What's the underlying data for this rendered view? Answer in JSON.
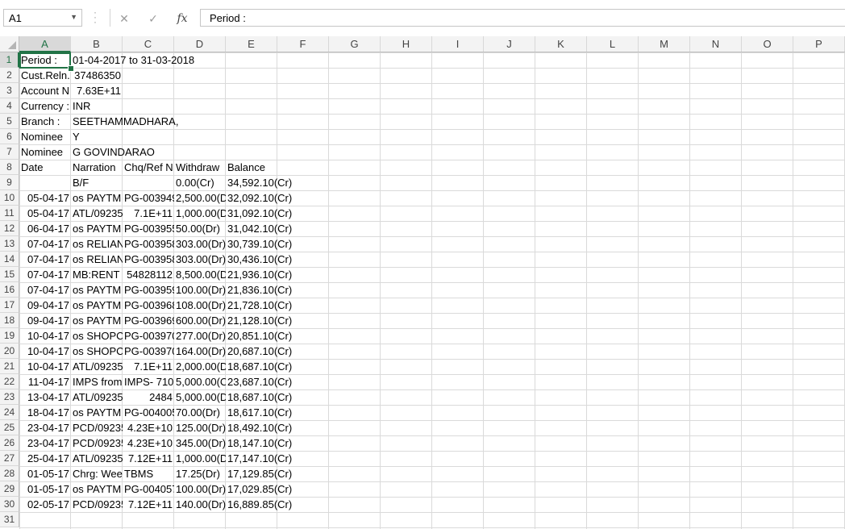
{
  "formula_bar": {
    "name_box": "A1",
    "cancel_icon": "✕",
    "enter_icon": "✓",
    "fx_label": "fx",
    "formula_value": "Period :"
  },
  "columns": [
    "A",
    "B",
    "C",
    "D",
    "E",
    "F",
    "G",
    "H",
    "I",
    "J",
    "K",
    "L",
    "M",
    "N",
    "O",
    "P"
  ],
  "rows": [
    {
      "num": "1",
      "A": "Period :",
      "B": "01-04-2017 to 31-03-2018"
    },
    {
      "num": "2",
      "A": "Cust.Reln.",
      "B": "37486350",
      "B_align": "r"
    },
    {
      "num": "3",
      "A": "Account N",
      "B": "7.63E+11",
      "B_align": "r"
    },
    {
      "num": "4",
      "A": "Currency :",
      "B": "INR"
    },
    {
      "num": "5",
      "A": "Branch :",
      "B": "SEETHAMMADHARA,"
    },
    {
      "num": "6",
      "A": "Nominee",
      "B": "Y"
    },
    {
      "num": "7",
      "A": "Nominee",
      "B": "G GOVINDARAO"
    },
    {
      "num": "8",
      "A": "Date",
      "B": "Narration",
      "C": "Chq/Ref N",
      "D": "Withdraw",
      "E": "Balance"
    },
    {
      "num": "9",
      "A": "",
      "B": "B/F",
      "C": "",
      "D": "0.00(Cr)",
      "E": "34,592.10(Cr)"
    },
    {
      "num": "10",
      "A": "05-04-17",
      "B": "os PAYTM",
      "C": "PG-003949",
      "D": "2,500.00(D",
      "E": "32,092.10(Cr)"
    },
    {
      "num": "11",
      "A": "05-04-17",
      "B": "ATL/09235",
      "C": "7.1E+11",
      "D": "1,000.00(D",
      "E": "31,092.10(Cr)"
    },
    {
      "num": "12",
      "A": "06-04-17",
      "B": "os PAYTM",
      "C": "PG-003955",
      "D": "50.00(Dr)",
      "E": "31,042.10(Cr)"
    },
    {
      "num": "13",
      "A": "07-04-17",
      "B": "os RELIAN",
      "C": "PG-003958",
      "D": "303.00(Dr)",
      "E": "30,739.10(Cr)"
    },
    {
      "num": "14",
      "A": "07-04-17",
      "B": "os RELIAN",
      "C": "PG-003958",
      "D": "303.00(Dr)",
      "E": "30,436.10(Cr)"
    },
    {
      "num": "15",
      "A": "07-04-17",
      "B": "MB:RENT",
      "C": "54828112",
      "D": "8,500.00(D",
      "E": "21,936.10(Cr)"
    },
    {
      "num": "16",
      "A": "07-04-17",
      "B": "os PAYTM",
      "C": "PG-003959",
      "D": "100.00(Dr)",
      "E": "21,836.10(Cr)"
    },
    {
      "num": "17",
      "A": "09-04-17",
      "B": "os PAYTM",
      "C": "PG-003968",
      "D": "108.00(Dr)",
      "E": "21,728.10(Cr)"
    },
    {
      "num": "18",
      "A": "09-04-17",
      "B": "os PAYTM",
      "C": "PG-003969",
      "D": "600.00(Dr)",
      "E": "21,128.10(Cr)"
    },
    {
      "num": "19",
      "A": "10-04-17",
      "B": "os SHOPCI",
      "C": "PG-003970",
      "D": "277.00(Dr)",
      "E": "20,851.10(Cr)"
    },
    {
      "num": "20",
      "A": "10-04-17",
      "B": "os SHOPCI",
      "C": "PG-003970",
      "D": "164.00(Dr)",
      "E": "20,687.10(Cr)"
    },
    {
      "num": "21",
      "A": "10-04-17",
      "B": "ATL/09235",
      "C": "7.1E+11",
      "D": "2,000.00(D",
      "E": "18,687.10(Cr)"
    },
    {
      "num": "22",
      "A": "11-04-17",
      "B": "IMPS from",
      "C": "IMPS- 710",
      "D": "5,000.00(C",
      "E": "23,687.10(Cr)"
    },
    {
      "num": "23",
      "A": "13-04-17",
      "B": "ATL/09235",
      "C": "2484",
      "D": "5,000.00(D",
      "E": "18,687.10(Cr)"
    },
    {
      "num": "24",
      "A": "18-04-17",
      "B": "os PAYTM",
      "C": "PG-004005",
      "D": "70.00(Dr)",
      "E": "18,617.10(Cr)"
    },
    {
      "num": "25",
      "A": "23-04-17",
      "B": "PCD/09235",
      "C": "4.23E+10",
      "D": "125.00(Dr)",
      "E": "18,492.10(Cr)"
    },
    {
      "num": "26",
      "A": "23-04-17",
      "B": "PCD/09235",
      "C": "4.23E+10",
      "D": "345.00(Dr)",
      "E": "18,147.10(Cr)"
    },
    {
      "num": "27",
      "A": "25-04-17",
      "B": "ATL/09235",
      "C": "7.12E+11",
      "D": "1,000.00(D",
      "E": "17,147.10(Cr)"
    },
    {
      "num": "28",
      "A": "01-05-17",
      "B": "Chrg: Wee",
      "C": "TBMS",
      "D": "17.25(Dr)",
      "E": "17,129.85(Cr)"
    },
    {
      "num": "29",
      "A": "01-05-17",
      "B": "os PAYTM",
      "C": "PG-004057",
      "D": "100.00(Dr)",
      "E": "17,029.85(Cr)"
    },
    {
      "num": "30",
      "A": "02-05-17",
      "B": "PCD/09235",
      "C": "7.12E+11",
      "D": "140.00(Dr)",
      "E": "16,889.85(Cr)"
    },
    {
      "num": "31"
    }
  ]
}
